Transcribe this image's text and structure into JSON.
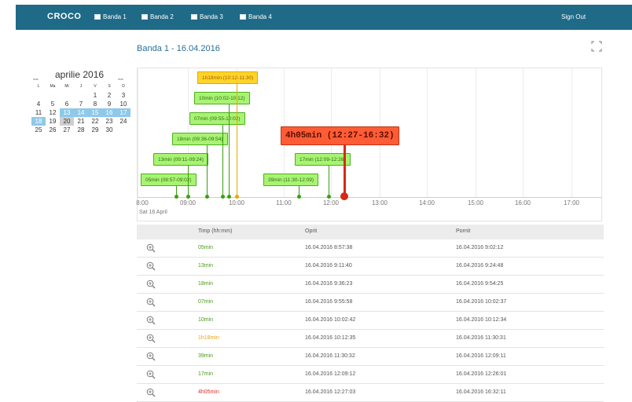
{
  "navbar": {
    "brand": "CROCO",
    "items": [
      {
        "label": "Banda 1"
      },
      {
        "label": "Banda 2"
      },
      {
        "label": "Banda 3"
      },
      {
        "label": "Banda 4"
      }
    ],
    "sign_out": "Sign Out",
    "bg_color": "#1f6a87"
  },
  "page_title": "Banda 1 - 16.04.2016",
  "calendar": {
    "month": "aprilie 2016",
    "prev": "mai.",
    "next": "mai.",
    "weekdays": [
      "L",
      "Ma",
      "Mi",
      "J",
      "V",
      "S",
      "D"
    ],
    "weeks": [
      [
        "",
        "",
        "",
        "",
        "1",
        "2",
        "3"
      ],
      [
        "4",
        "5",
        "6",
        "7",
        "8",
        "9",
        "10"
      ],
      [
        "11",
        "12",
        "13",
        "14",
        "15",
        "16",
        "17"
      ],
      [
        "18",
        "19",
        "20",
        "21",
        "22",
        "23",
        "24"
      ],
      [
        "25",
        "26",
        "27",
        "28",
        "29",
        "30",
        ""
      ]
    ],
    "selected_days": [
      "13",
      "14",
      "15",
      "16",
      "17",
      "18"
    ],
    "today": "20"
  },
  "timeline": {
    "ticks": [
      "8:00",
      "09:00",
      "10:00",
      "11:00",
      "12:00",
      "13:00",
      "14:00",
      "15:00",
      "16:00",
      "17:00"
    ],
    "date_label": "Sat 16 April",
    "events": [
      {
        "label": "05min (08:57-09:02)",
        "color": "green"
      },
      {
        "label": "13min (09:11-09:24)",
        "color": "green"
      },
      {
        "label": "18min (09:36-09:54)",
        "color": "green"
      },
      {
        "label": "07min (09:55-10:02)",
        "color": "green"
      },
      {
        "label": "10min (10:02-10:12)",
        "color": "green"
      },
      {
        "label": "1h18min (10:12-11:30)",
        "color": "orange"
      },
      {
        "label": "39min (11:30-12:09)",
        "color": "green"
      },
      {
        "label": "17min (12:09-12:26)",
        "color": "green"
      },
      {
        "label": "4h05min (12:27-16:32)",
        "color": "red"
      }
    ],
    "colors": {
      "green": "#a9f374",
      "orange": "#ffd42a",
      "red": "#ff5c35"
    }
  },
  "table": {
    "headers": [
      "Timp (hh:mm)",
      "Oprit",
      "Pornit"
    ],
    "rows": [
      {
        "timp": "05min",
        "oprit": "16.04.2016 8:57:38",
        "pornit": "16.04.2016 9:02:12",
        "color": "#4a9a1a"
      },
      {
        "timp": "13min",
        "oprit": "16.04.2016 9:11:40",
        "pornit": "16.04.2016 9:24:48",
        "color": "#4a9a1a"
      },
      {
        "timp": "18min",
        "oprit": "16.04.2016 9:36:23",
        "pornit": "16.04.2016 9:54:25",
        "color": "#4a9a1a"
      },
      {
        "timp": "07min",
        "oprit": "16.04.2016 9:55:58",
        "pornit": "16.04.2016 10:02:37",
        "color": "#4a9a1a"
      },
      {
        "timp": "10min",
        "oprit": "16.04.2016 10:02:42",
        "pornit": "16.04.2016 10:12:34",
        "color": "#4a9a1a"
      },
      {
        "timp": "1h18min",
        "oprit": "16.04.2016 10:12:35",
        "pornit": "16.04.2016 11:30:31",
        "color": "#e8a21a"
      },
      {
        "timp": "39min",
        "oprit": "16.04.2016 11:30:32",
        "pornit": "16.04.2016 12:09:11",
        "color": "#4a9a1a"
      },
      {
        "timp": "17min",
        "oprit": "16.04.2016 12:09:12",
        "pornit": "16.04.2016 12:26:01",
        "color": "#4a9a1a"
      },
      {
        "timp": "4h05min",
        "oprit": "16.04.2016 12:27:03",
        "pornit": "16.04.2016 16:32:11",
        "color": "#d9332a"
      }
    ]
  }
}
